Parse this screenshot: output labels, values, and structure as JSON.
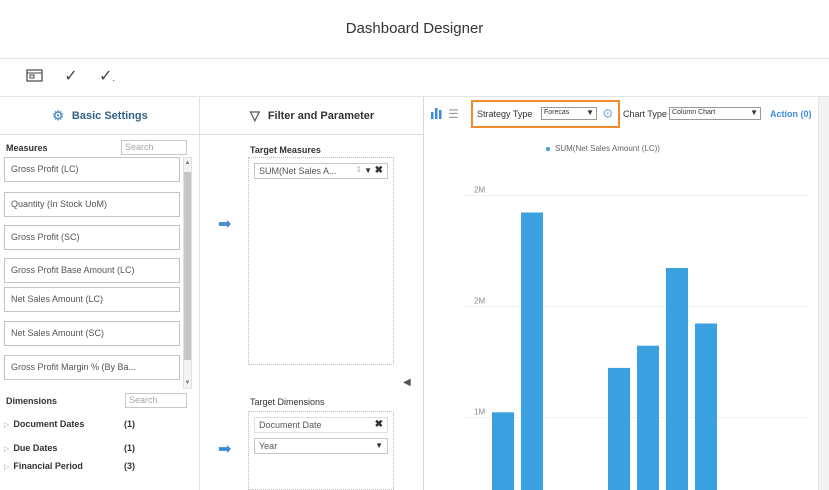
{
  "window": {
    "title": "Dashboard Designer"
  },
  "toolbar": {
    "icons": [
      "open-dialog-icon",
      "check-icon",
      "check-all-icon"
    ]
  },
  "left_panel": {
    "tab_label": "Basic Settings",
    "measures": {
      "label": "Measures",
      "search_placeholder": "Search",
      "items": [
        "Gross Profit (LC)",
        "Quantity (In Stock UoM)",
        "Gross Profit (SC)",
        "Gross Profit Base Amount (LC)",
        "Net Sales Amount (LC)",
        "Net Sales Amount (SC)",
        "Gross Profit Margin % (By Ba..."
      ]
    },
    "dimensions": {
      "label": "Dimensions",
      "search_placeholder": "Search",
      "items": [
        {
          "label": "Document Dates",
          "count": "(1)"
        },
        {
          "label": "Due Dates",
          "count": "(1)"
        },
        {
          "label": "Financial Period",
          "count": "(3)"
        }
      ]
    }
  },
  "mid_panel": {
    "tab_label": "Filter and Parameter",
    "target_measures": {
      "label": "Target Measures",
      "chip": "SUM(Net Sales A..."
    },
    "target_dimensions": {
      "label": "Target Dimensions",
      "chip": "Document Date",
      "select_value": "Year"
    }
  },
  "right_panel": {
    "strategy_label": "Strategy Type",
    "strategy_value": "Forecas",
    "chart_type_label": "Chart Type",
    "chart_type_value": "Column Chart",
    "action_link": "Action (0)",
    "legend": "SUM(Net Sales Amount (LC))",
    "accent": "#3aa0e0",
    "highlight": "#f08c2a"
  },
  "chart_data": {
    "type": "bar",
    "legend": [
      "SUM(Net Sales Amount (LC))"
    ],
    "ytick_labels": [
      "2M",
      "2M",
      "1M"
    ],
    "series": [
      {
        "name": "SUM(Net Sales Amount (LC))",
        "values": [
          0.7,
          2.5,
          null,
          null,
          1.1,
          1.3,
          2.0,
          1.5
        ]
      }
    ],
    "ylim": [
      0,
      3
    ],
    "grid": true
  }
}
